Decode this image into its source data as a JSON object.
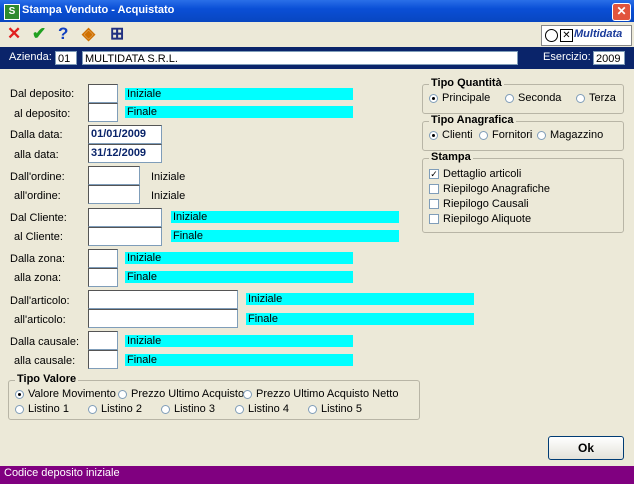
{
  "window": {
    "title": "Stampa Venduto - Acquistato",
    "icon_label": "S",
    "close_glyph": "✕"
  },
  "toolbar": {
    "cancel_glyph": "✕",
    "confirm_glyph": "✔",
    "help_glyph": "?",
    "print_glyph": "◈",
    "search_glyph": "⊞"
  },
  "logo": {
    "text": "Multidata",
    "box_glyph": "✕"
  },
  "header": {
    "azienda_label": "Azienda:",
    "azienda_code": "01",
    "azienda_name": "MULTIDATA S.R.L.",
    "esercizio_label": "Esercizio:",
    "esercizio_value": "2009"
  },
  "form": {
    "dal_deposito": "Dal deposito:",
    "al_deposito": "al deposito:",
    "dalla_data": "Dalla data:",
    "alla_data": "alla data:",
    "data_from": "01/01/2009",
    "data_to": "31/12/2009",
    "dall_ordine": "Dall'ordine:",
    "all_ordine": "all'ordine:",
    "dal_cliente": "Dal Cliente:",
    "al_cliente": "al Cliente:",
    "dalla_zona": "Dalla zona:",
    "alla_zona": "alla zona:",
    "dall_articolo": "Dall'articolo:",
    "all_articolo": "all'articolo:",
    "dalla_causale": "Dalla causale:",
    "alla_causale": "alla causale:",
    "iniziale": "Iniziale",
    "finale": "Finale"
  },
  "tipo_valore": {
    "title": "Tipo Valore",
    "options": [
      "Valore Movimento",
      "Prezzo Ultimo Acquisto",
      "Prezzo Ultimo Acquisto Netto",
      "Listino 1",
      "Listino 2",
      "Listino 3",
      "Listino 4",
      "Listino 5"
    ],
    "selected": "Valore Movimento"
  },
  "tipo_quantita": {
    "title": "Tipo Quantità",
    "options": [
      "Principale",
      "Seconda",
      "Terza"
    ],
    "selected": "Principale"
  },
  "tipo_anagrafica": {
    "title": "Tipo Anagrafica",
    "options": [
      "Clienti",
      "Fornitori",
      "Magazzino"
    ],
    "selected": "Clienti"
  },
  "stampa": {
    "title": "Stampa",
    "options": [
      "Dettaglio articoli",
      "Riepilogo Anagrafiche",
      "Riepilogo Causali",
      "Riepilogo Aliquote"
    ],
    "checked": [
      true,
      false,
      false,
      false
    ]
  },
  "ok_button": "Ok",
  "status": "Codice deposito iniziale",
  "colors": {
    "title_bar": "#0a4fd6",
    "header": "#0a246a",
    "highlight": "#00ffff",
    "status_bar": "#800080"
  }
}
